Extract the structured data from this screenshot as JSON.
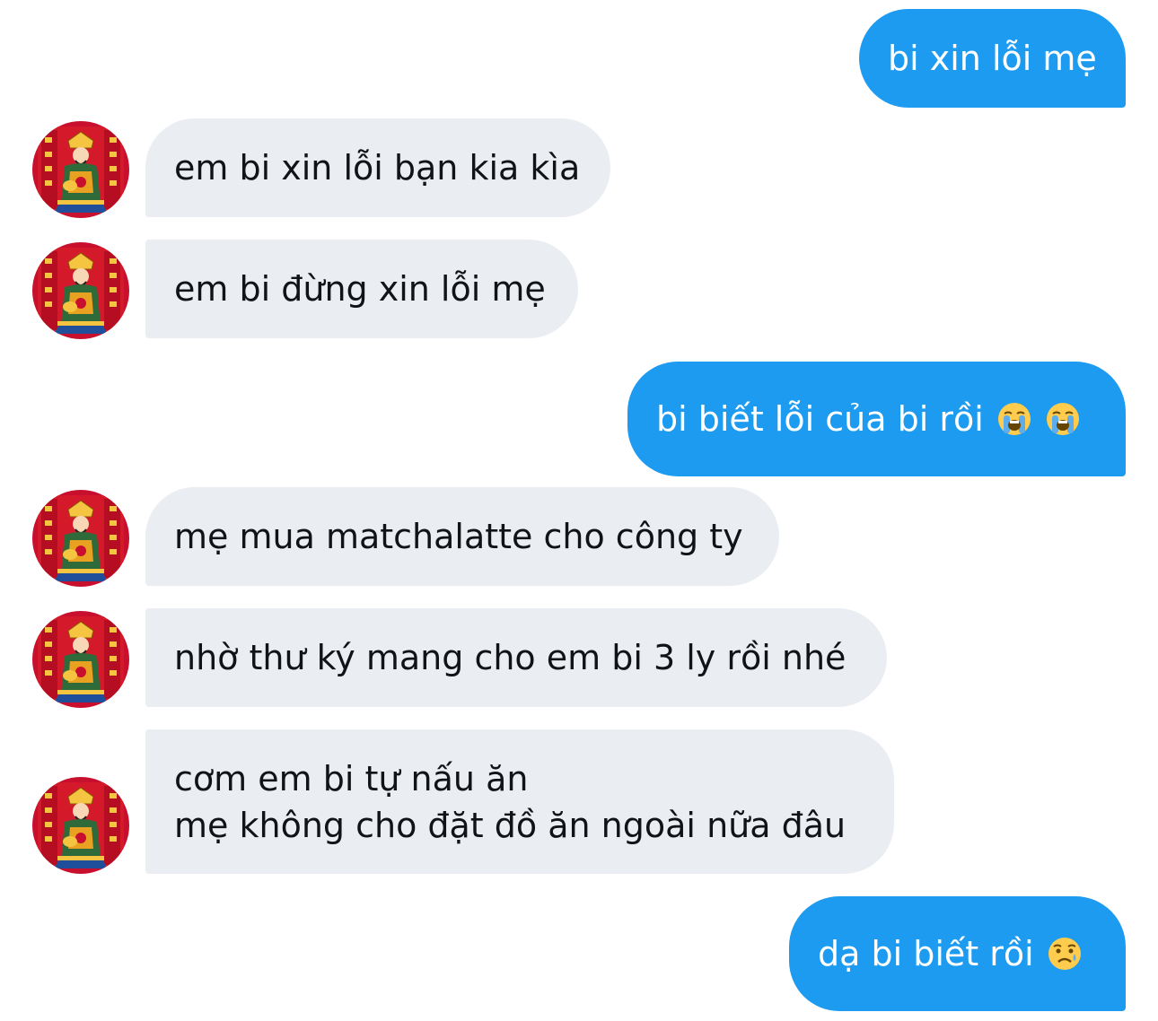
{
  "colors": {
    "outgoing_bubble": "#1d9bf0",
    "incoming_bubble": "#eaedf1",
    "outgoing_text": "#ffffff",
    "incoming_text": "#101418"
  },
  "avatar": {
    "icon": "god-of-wealth-avatar-icon"
  },
  "messages": [
    {
      "direction": "out",
      "text": "bi xin lỗi mẹ"
    },
    {
      "direction": "in",
      "text": "em bi xin lỗi bạn kia kìa"
    },
    {
      "direction": "in",
      "text": "em bi đừng xin lỗi mẹ"
    },
    {
      "direction": "out",
      "text": "bi biết lỗi của bi rồi",
      "emojis": [
        "loudly-crying-face-emoji",
        "loudly-crying-face-emoji"
      ]
    },
    {
      "direction": "in",
      "text": "mẹ mua matchalatte cho công ty"
    },
    {
      "direction": "in",
      "text": "nhờ thư ký mang cho em bi 3 ly rồi nhé"
    },
    {
      "direction": "in",
      "text": "cơm em bi tự nấu ăn\nmẹ không cho đặt đồ ăn ngoài nữa đâu"
    },
    {
      "direction": "out",
      "text": "dạ bi biết rồi",
      "emojis": [
        "sad-but-relieved-face-emoji"
      ]
    }
  ]
}
